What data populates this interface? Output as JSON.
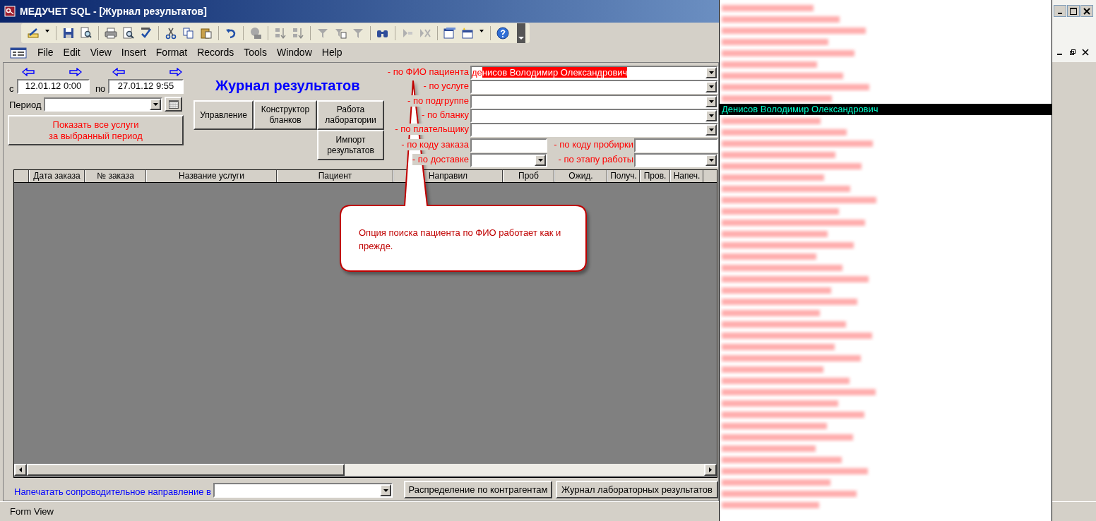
{
  "window": {
    "title": "МЕДУЧЕТ SQL - [Журнал результатов]"
  },
  "menu": [
    "File",
    "Edit",
    "View",
    "Insert",
    "Format",
    "Records",
    "Tools",
    "Window",
    "Help"
  ],
  "form": {
    "date_from": {
      "label": "с",
      "value": "12.01.12 0:00"
    },
    "date_to": {
      "label": "по",
      "value": "27.01.12 9:55"
    },
    "period": {
      "label": "Период"
    },
    "show_all_button": "Показать все услуги\nза выбранный период",
    "heading": "Журнал результатов",
    "buttons": [
      "Управление",
      "Конструктор бланков",
      "Работа лаборатории",
      "Импорт результатов"
    ],
    "filters": [
      {
        "label": "- по ФИО пациента",
        "kind": "combo",
        "typed": "де",
        "suggested": "нисов Володимир Олександрович"
      },
      {
        "label": "- по услуге",
        "kind": "combo"
      },
      {
        "label": "- по подгруппе",
        "kind": "combo"
      },
      {
        "label": "- по бланку",
        "kind": "combo"
      },
      {
        "label": "- по плательщику",
        "kind": "combo"
      },
      {
        "label": "- по коду заказа",
        "kind": "text"
      },
      {
        "label": "- по коду пробирки",
        "kind": "text"
      },
      {
        "label": "- по доставке",
        "kind": "combo"
      },
      {
        "label": "- по этапу работы",
        "kind": "combo"
      }
    ],
    "grid": {
      "columns": [
        "Дата заказа",
        "№ заказа",
        "Название услуги",
        "Пациент",
        "Направил",
        "Проб",
        "Ожид.",
        "Получ.",
        "Пров.",
        "Напеч."
      ]
    },
    "print_label": "Напечатать сопроводительное направление в",
    "bottom_buttons": [
      "Распределение по контрагентам",
      "Журнал лабораторных результатов"
    ]
  },
  "callout": {
    "text": "Опция поиска пациента по ФИО работает как и прежде."
  },
  "dropdown": {
    "items": [
      {
        "kind": "redacted",
        "selected": false
      },
      {
        "kind": "redacted",
        "selected": false
      },
      {
        "kind": "redacted",
        "selected": false
      },
      {
        "kind": "redacted",
        "selected": false
      },
      {
        "kind": "redacted",
        "selected": false
      },
      {
        "kind": "redacted",
        "selected": false
      },
      {
        "kind": "redacted",
        "selected": false
      },
      {
        "kind": "redacted",
        "selected": false
      },
      {
        "kind": "redacted",
        "selected": false
      },
      {
        "kind": "name",
        "text": "Денисов Володимир Олександрович",
        "selected": true
      },
      {
        "kind": "redacted",
        "selected": false
      },
      {
        "kind": "redacted",
        "selected": false
      },
      {
        "kind": "redacted",
        "selected": false
      },
      {
        "kind": "redacted",
        "selected": false
      },
      {
        "kind": "redacted",
        "selected": false
      },
      {
        "kind": "redacted",
        "selected": false
      },
      {
        "kind": "redacted",
        "selected": false
      },
      {
        "kind": "redacted",
        "selected": false
      },
      {
        "kind": "redacted",
        "selected": false
      },
      {
        "kind": "redacted",
        "selected": false
      },
      {
        "kind": "redacted",
        "selected": false
      },
      {
        "kind": "redacted",
        "selected": false
      },
      {
        "kind": "redacted",
        "selected": false
      },
      {
        "kind": "redacted",
        "selected": false
      },
      {
        "kind": "redacted",
        "selected": false
      },
      {
        "kind": "redacted",
        "selected": false
      },
      {
        "kind": "redacted",
        "selected": false
      },
      {
        "kind": "redacted",
        "selected": false
      },
      {
        "kind": "redacted",
        "selected": false
      },
      {
        "kind": "redacted",
        "selected": false
      },
      {
        "kind": "redacted",
        "selected": false
      },
      {
        "kind": "redacted",
        "selected": false
      },
      {
        "kind": "redacted",
        "selected": false
      },
      {
        "kind": "redacted",
        "selected": false
      },
      {
        "kind": "redacted",
        "selected": false
      },
      {
        "kind": "redacted",
        "selected": false
      },
      {
        "kind": "redacted",
        "selected": false
      },
      {
        "kind": "redacted",
        "selected": false
      },
      {
        "kind": "redacted",
        "selected": false
      },
      {
        "kind": "redacted",
        "selected": false
      },
      {
        "kind": "redacted",
        "selected": false
      },
      {
        "kind": "redacted",
        "selected": false
      },
      {
        "kind": "redacted",
        "selected": false
      },
      {
        "kind": "redacted",
        "selected": false
      },
      {
        "kind": "redacted",
        "selected": false
      }
    ]
  },
  "status_bar": "Form View"
}
